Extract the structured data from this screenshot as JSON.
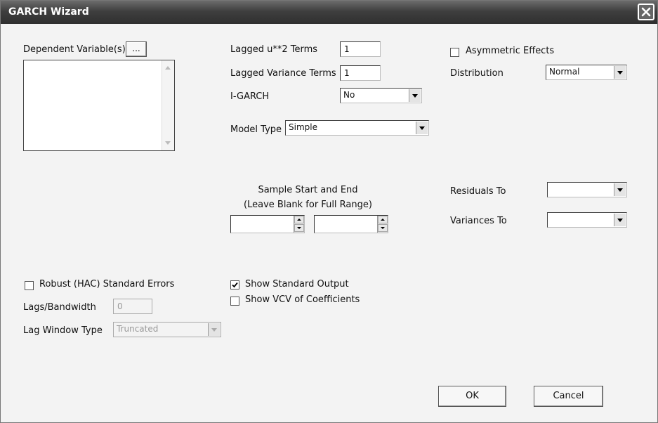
{
  "window": {
    "title": "GARCH Wizard"
  },
  "dependent": {
    "label": "Dependent Variable(s)",
    "browse_label": "..."
  },
  "lagged_u2": {
    "label": "Lagged u**2 Terms",
    "value": "1"
  },
  "lagged_var": {
    "label": "Lagged Variance Terms",
    "value": "1"
  },
  "igarch": {
    "label": "I-GARCH",
    "value": "No"
  },
  "model_type": {
    "label": "Model Type",
    "value": "Simple"
  },
  "asymmetric": {
    "label": "Asymmetric Effects",
    "checked": false
  },
  "distribution": {
    "label": "Distribution",
    "value": "Normal"
  },
  "sample": {
    "line1": "Sample Start and End",
    "line2": "(Leave Blank for Full Range)",
    "start": "",
    "end": ""
  },
  "residuals": {
    "label": "Residuals To",
    "value": ""
  },
  "variances": {
    "label": "Variances To",
    "value": ""
  },
  "robust": {
    "label": "Robust (HAC) Standard Errors",
    "checked": false
  },
  "lags": {
    "label": "Lags/Bandwidth",
    "value": "0"
  },
  "lag_window": {
    "label": "Lag Window Type",
    "value": "Truncated"
  },
  "show_output": {
    "label": "Show Standard Output",
    "checked": true
  },
  "show_vcv": {
    "label": "Show VCV of Coefficients",
    "checked": false
  },
  "buttons": {
    "ok": "OK",
    "cancel": "Cancel"
  }
}
